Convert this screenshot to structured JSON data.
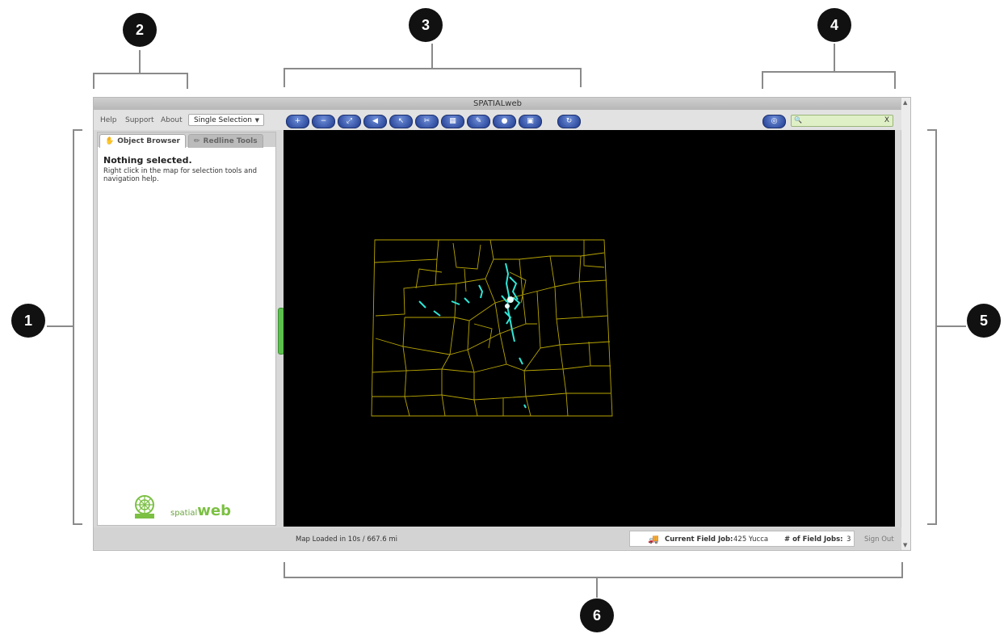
{
  "callouts": [
    "1",
    "2",
    "3",
    "4",
    "5",
    "6"
  ],
  "window": {
    "title": "SPATIALweb"
  },
  "menu": {
    "help": "Help",
    "support": "Support",
    "about": "About"
  },
  "selection_mode": {
    "value": "Single Selection"
  },
  "toolbar_buttons": [
    {
      "icon": "zoom-in-icon",
      "glyph": "+"
    },
    {
      "icon": "zoom-out-icon",
      "glyph": "−"
    },
    {
      "icon": "zoom-extent-icon",
      "glyph": "⤢"
    },
    {
      "icon": "back-icon",
      "glyph": "◀"
    },
    {
      "icon": "select-icon",
      "glyph": "↖"
    },
    {
      "icon": "measure-icon",
      "glyph": "✂"
    },
    {
      "icon": "layers-icon",
      "glyph": "▦"
    },
    {
      "icon": "pen-icon",
      "glyph": "✎"
    },
    {
      "icon": "info-icon",
      "glyph": "●"
    },
    {
      "icon": "print-icon",
      "glyph": "▣"
    },
    {
      "icon": "refresh-icon",
      "glyph": "↻"
    }
  ],
  "search": {
    "value": "",
    "clear": "X"
  },
  "panel": {
    "tab_object_browser": "Object Browser",
    "tab_redline_tools": "Redline Tools",
    "title": "Nothing selected.",
    "body": "Right click in the map for selection tools and navigation help.",
    "logo_small": "spatial",
    "logo_big": "web"
  },
  "status": {
    "map_loaded": "Map Loaded in 10s / 667.6 mi",
    "current_field_job_label": "Current Field Job:",
    "current_field_job_value": "425 Yucca",
    "num_field_jobs_label": "# of Field Jobs:",
    "num_field_jobs_value": "3",
    "sign_out": "Sign Out"
  },
  "colors": {
    "map_background": "#000000",
    "boundary_lines": "#b8a500",
    "features": "#2fe6d6",
    "accent_green": "#7bc043",
    "button_blue": "#2c4ea8"
  }
}
